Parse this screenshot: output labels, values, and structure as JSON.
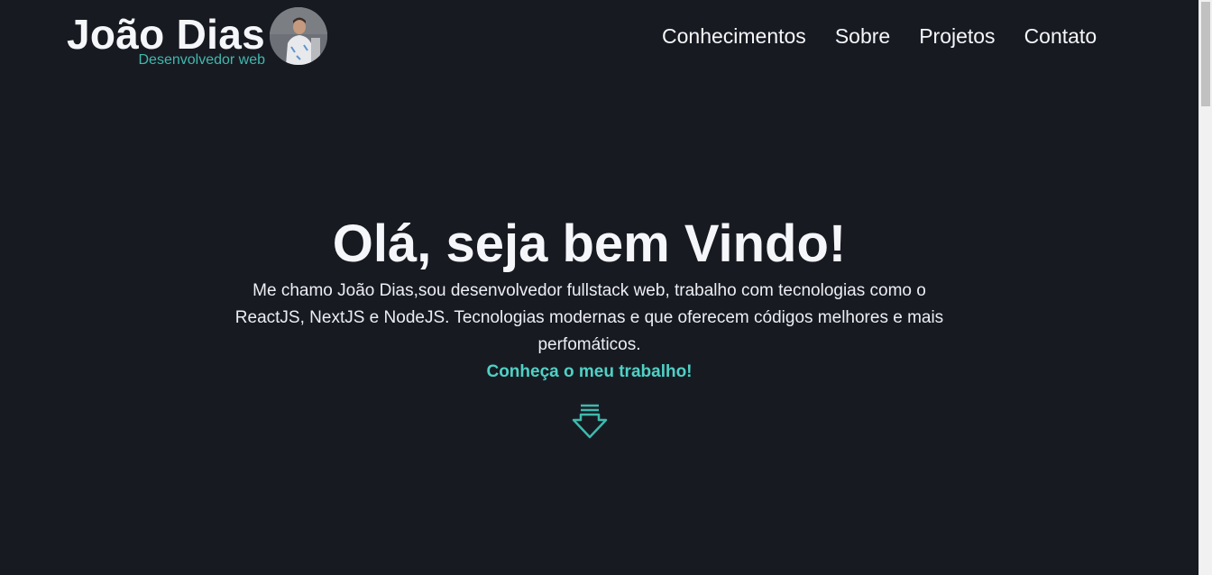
{
  "header": {
    "name": "João Dias",
    "role": "Desenvolvedor web",
    "nav": [
      {
        "label": "Conhecimentos"
      },
      {
        "label": "Sobre"
      },
      {
        "label": "Projetos"
      },
      {
        "label": "Contato"
      }
    ]
  },
  "hero": {
    "title": "Olá, seja bem Vindo!",
    "description": "Me chamo João Dias,sou desenvolvedor fullstack web, trabalho com tecnologias como o ReactJS, NextJS e NodeJS. Tecnologias modernas e que oferecem códigos melhores e mais perfomáticos.",
    "cta": "Conheça o meu trabalho!",
    "arrow_icon": "arrow-down-icon"
  },
  "colors": {
    "background": "#181a22",
    "text": "#f5f6fa",
    "accent": "#4fd1c5",
    "accent_dim": "#3fb9ad"
  }
}
